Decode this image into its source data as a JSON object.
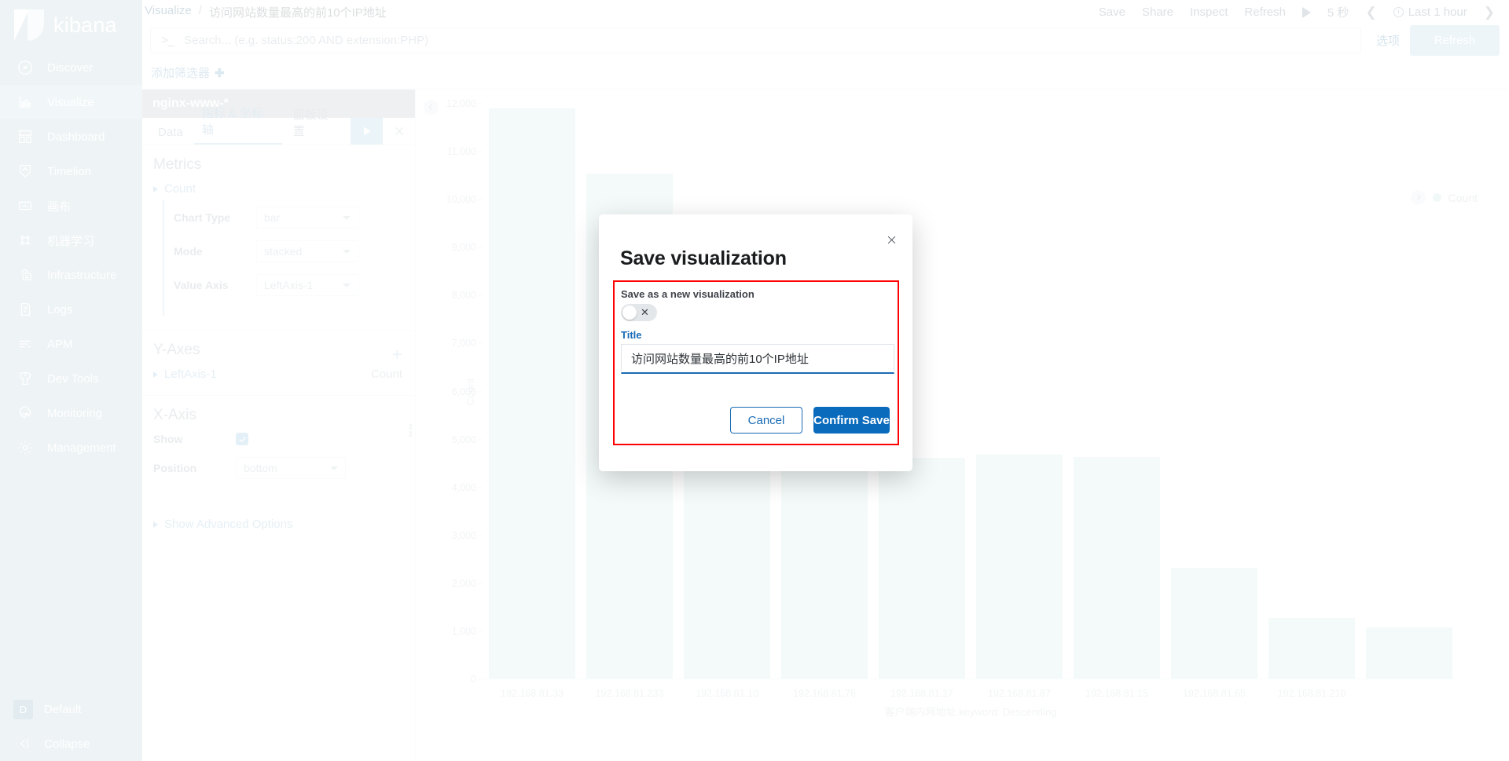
{
  "app": {
    "name": "kibana"
  },
  "sidebar": {
    "items": [
      {
        "label": "Discover",
        "icon": "compass-icon",
        "active": false
      },
      {
        "label": "Visualize",
        "icon": "bar-chart-icon",
        "active": true
      },
      {
        "label": "Dashboard",
        "icon": "dashboard-icon",
        "active": false
      },
      {
        "label": "Timelion",
        "icon": "timelion-icon",
        "active": false
      },
      {
        "label": "画布",
        "icon": "canvas-icon",
        "active": false
      },
      {
        "label": "机器学习",
        "icon": "machine-learning-icon",
        "active": false
      },
      {
        "label": "Infrastructure",
        "icon": "infrastructure-icon",
        "active": false
      },
      {
        "label": "Logs",
        "icon": "logs-icon",
        "active": false
      },
      {
        "label": "APM",
        "icon": "apm-icon",
        "active": false
      },
      {
        "label": "Dev Tools",
        "icon": "wrench-icon",
        "active": false
      },
      {
        "label": "Monitoring",
        "icon": "monitoring-icon",
        "active": false
      },
      {
        "label": "Management",
        "icon": "gear-icon",
        "active": false
      }
    ],
    "space": "Default",
    "space_initial": "D",
    "collapse": "Collapse"
  },
  "breadcrumb": {
    "root": "Visualize",
    "separator": "/",
    "current": "访问网站数量最高的前10个IP地址"
  },
  "topbar": {
    "save": "Save",
    "share": "Share",
    "inspect": "Inspect",
    "refresh": "Refresh",
    "interval": "5 秒",
    "time_range": "Last 1 hour"
  },
  "search": {
    "placeholder": "Search... (e.g. status:200 AND extension:PHP)",
    "value": ""
  },
  "query_actions": {
    "options": "选项",
    "refresh": "Refresh"
  },
  "filters": {
    "add_filter": "添加筛选器"
  },
  "editor": {
    "index_pattern": "nginx-www-*",
    "tabs": [
      {
        "label": "Data",
        "active": false
      },
      {
        "label": "指标 & 坐标轴",
        "active": true
      },
      {
        "label": "面板设置",
        "active": false
      }
    ],
    "metrics": {
      "heading": "Metrics",
      "agg": "Count",
      "fields": [
        {
          "label": "Chart Type",
          "value": "bar"
        },
        {
          "label": "Mode",
          "value": "stacked"
        },
        {
          "label": "Value Axis",
          "value": "LeftAxis-1"
        }
      ]
    },
    "y_axes": {
      "heading": "Y-Axes",
      "add": "+",
      "axis": "LeftAxis-1",
      "axis_metric": "Count"
    },
    "x_axis": {
      "heading": "X-Axis",
      "show_label": "Show",
      "show_checked": true,
      "position_label": "Position",
      "position_value": "bottom",
      "advanced": "Show Advanced Options"
    }
  },
  "legend": {
    "series": "Count",
    "color": "#cfeae6"
  },
  "modal": {
    "title": "Save visualization",
    "save_as_new_label": "Save as a new visualization",
    "save_as_new_on": false,
    "title_field_label": "Title",
    "title_field_value": "访问网站数量最高的前10个IP地址",
    "cancel": "Cancel",
    "confirm": "Confirm Save",
    "highlight_color": "#fe0000"
  },
  "chart_data": {
    "type": "bar",
    "title": "",
    "xlabel": "客户端内网地址.keyword: Descending",
    "ylabel": "Count",
    "ylim": [
      0,
      12000
    ],
    "yticks": [
      0,
      1000,
      2000,
      3000,
      4000,
      5000,
      6000,
      7000,
      8000,
      9000,
      10000,
      11000,
      12000
    ],
    "ytick_labels": [
      "0",
      "1,000",
      "2,000",
      "3,000",
      "4,000",
      "5,000",
      "6,000",
      "7,000",
      "8,000",
      "9,000",
      "10,000",
      "11,000",
      "12,000"
    ],
    "grid": false,
    "legend_position": "top-right",
    "series_name": "Count",
    "bar_color": "#d7efec",
    "categories": [
      "192.168.81.33",
      "192.168.81.233",
      "192.168.81.10",
      "192.168.81.76",
      "192.168.81.17",
      "192.168.81.87",
      "192.168.81.15",
      "192.168.81.65",
      "192.168.81.210"
    ],
    "x_tick_labels": [
      "192.168.81.33",
      "192.168.81.233",
      "192.168.81.10",
      "192.168.81.76",
      "192.168.81.17",
      "192.168.81.87",
      "192.168.81.15",
      "192.168.81.65",
      "192.168.81.210"
    ],
    "values": [
      11900,
      10550,
      4620,
      4620,
      4620,
      4680,
      4640,
      2320,
      1280,
      1080
    ]
  }
}
